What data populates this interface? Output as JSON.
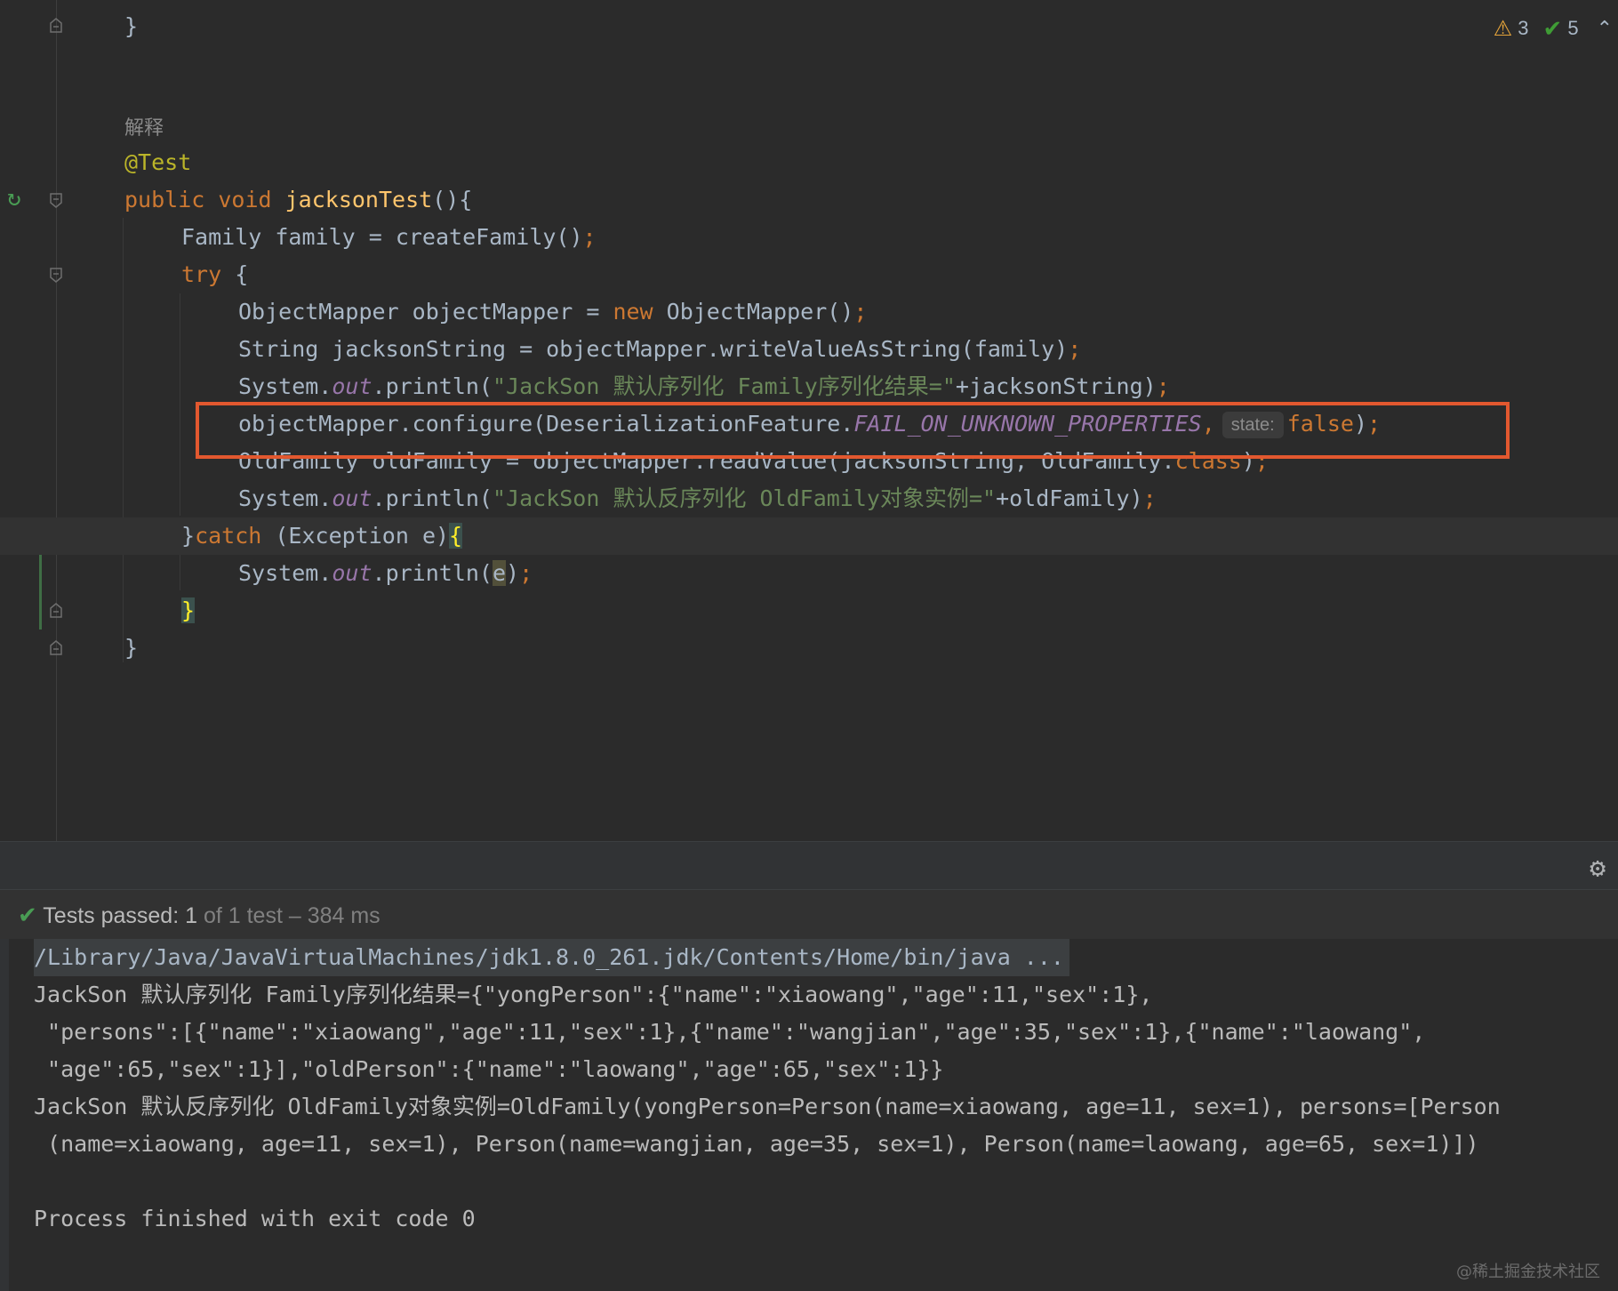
{
  "status": {
    "warnings": "3",
    "checks": "5"
  },
  "code": {
    "l0_brace": "}",
    "doc_label": "解释",
    "annotation": "@Test",
    "method_public": "public ",
    "method_void": "void ",
    "method_name": "jacksonTest",
    "method_tail": "(){",
    "l2": "Family family = createFamily()",
    "semi": ";",
    "try_kw": "try",
    "try_tail": " {",
    "l4_a": "ObjectMapper objectMapper = ",
    "new_kw": "new",
    "l4_b": " ObjectMapper()",
    "l5": "String jacksonString = objectMapper.writeValueAsString(family)",
    "sys": "System.",
    "out": "out",
    "println_open": ".println(",
    "l6_str": "\"JackSon 默认序列化 Family序列化结果=\"",
    "l6_tail": "+jacksonString)",
    "l7_a": "objectMapper.configure(DeserializationFeature.",
    "l7_const": "FAIL_ON_UNKNOWN_PROPERTIES",
    "comma": ",",
    "hint_state": "state:",
    "l7_false": "false",
    "l7_close": ")",
    "l8_a": "OldFamily oldFamily = objectMapper.readValue(jacksonString, OldFamily.",
    "class_kw": "class",
    "l9_str": "\"JackSon 默认反序列化 OldFamily对象实例=\"",
    "l9_tail": "+oldFamily)",
    "catch_open": "}",
    "catch_kw": "catch",
    "catch_tail": " (Exception e)",
    "open_brace": "{",
    "l11_e": "e",
    "close_brace": "}"
  },
  "tests": {
    "label": "Tests passed: ",
    "count": "1",
    "rest": " of 1 test – 384 ms"
  },
  "console": {
    "path": "/Library/Java/JavaVirtualMachines/jdk1.8.0_261.jdk/Contents/Home/bin/java ...",
    "line1": "JackSon 默认序列化 Family序列化结果={\"yongPerson\":{\"name\":\"xiaowang\",\"age\":11,\"sex\":1},",
    "line2": " \"persons\":[{\"name\":\"xiaowang\",\"age\":11,\"sex\":1},{\"name\":\"wangjian\",\"age\":35,\"sex\":1},{\"name\":\"laowang\",",
    "line3": " \"age\":65,\"sex\":1}],\"oldPerson\":{\"name\":\"laowang\",\"age\":65,\"sex\":1}}",
    "line4": "JackSon 默认反序列化 OldFamily对象实例=OldFamily(yongPerson=Person(name=xiaowang, age=11, sex=1), persons=[Person",
    "line5": " (name=xiaowang, age=11, sex=1), Person(name=wangjian, age=35, sex=1), Person(name=laowang, age=65, sex=1)])",
    "exit": "Process finished with exit code 0"
  },
  "watermark": "@稀土掘金技术社区"
}
